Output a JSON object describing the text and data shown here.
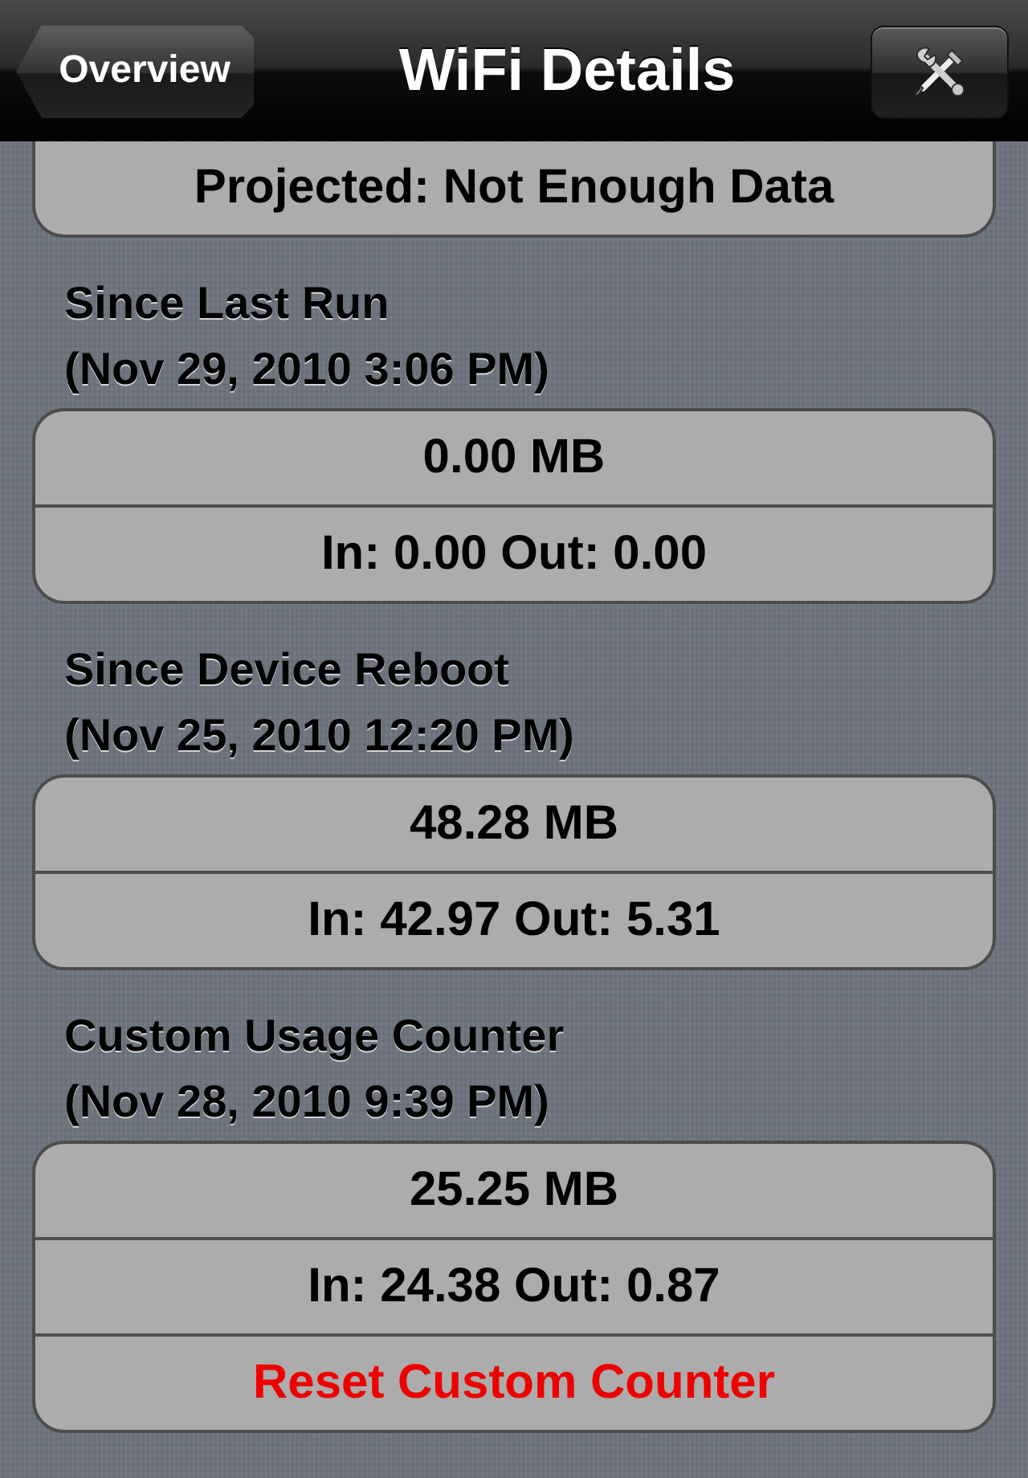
{
  "nav_bar": {
    "back_button": "Overview",
    "title": "WiFi Details"
  },
  "sections": [
    {
      "rows": [
        {
          "kind": "value",
          "text": "Projected: Not Enough Data"
        }
      ]
    },
    {
      "title": "Since Last Run",
      "subtitle": "(Nov 29, 2010 3:06 PM)",
      "rows": [
        {
          "kind": "value",
          "text": "0.00 MB"
        },
        {
          "kind": "value",
          "text": "In: 0.00 Out: 0.00"
        }
      ]
    },
    {
      "title": "Since Device Reboot",
      "subtitle": "(Nov 25, 2010 12:20 PM)",
      "rows": [
        {
          "kind": "value",
          "text": "48.28 MB"
        },
        {
          "kind": "value",
          "text": "In: 42.97 Out: 5.31"
        }
      ]
    },
    {
      "title": "Custom Usage Counter",
      "subtitle": "(Nov 28, 2010 9:39 PM)",
      "rows": [
        {
          "kind": "value",
          "text": "25.25 MB"
        },
        {
          "kind": "value",
          "text": "In: 24.38 Out: 0.87"
        },
        {
          "kind": "action",
          "text": "Reset Custom Counter"
        }
      ]
    }
  ]
}
